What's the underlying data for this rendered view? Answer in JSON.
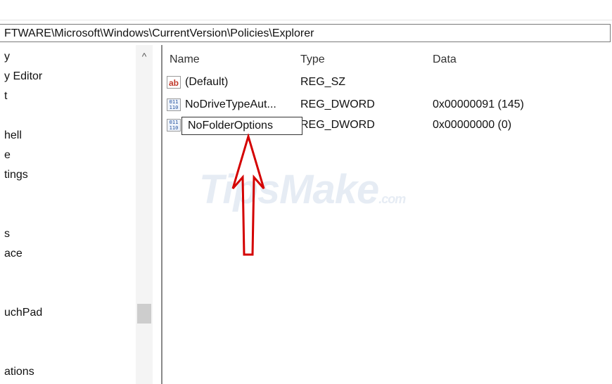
{
  "address_bar": {
    "path": "FTWARE\\Microsoft\\Windows\\CurrentVersion\\Policies\\Explorer"
  },
  "tree": {
    "items": [
      {
        "label": "y"
      },
      {
        "label": "y Editor"
      },
      {
        "label": "t"
      },
      {
        "label": "hell"
      },
      {
        "label": "e"
      },
      {
        "label": "tings"
      },
      {
        "label": "s"
      },
      {
        "label": "ace"
      },
      {
        "label": "uchPad"
      },
      {
        "label": "ations"
      }
    ],
    "scroll_up_glyph": "^"
  },
  "list": {
    "columns": {
      "name": "Name",
      "type": "Type",
      "data": "Data"
    },
    "rows": [
      {
        "icon": "string-value-icon",
        "name": "(Default)",
        "type": "REG_SZ",
        "data": ""
      },
      {
        "icon": "binary-value-icon",
        "name": "NoDriveTypeAut...",
        "type": "REG_DWORD",
        "data": "0x00000091 (145)"
      },
      {
        "icon": "binary-value-icon",
        "name": "",
        "type": "REG_DWORD",
        "data": "0x00000000 (0)"
      }
    ],
    "rename_value": "NoFolderOptions"
  },
  "icons": {
    "ab_text": "ab",
    "bin_top": "011",
    "bin_bottom": "110"
  },
  "watermark": {
    "main": "TipsMake",
    "suffix": ".com"
  },
  "colors": {
    "arrow": "#d40000",
    "watermark": "#5078b4"
  }
}
